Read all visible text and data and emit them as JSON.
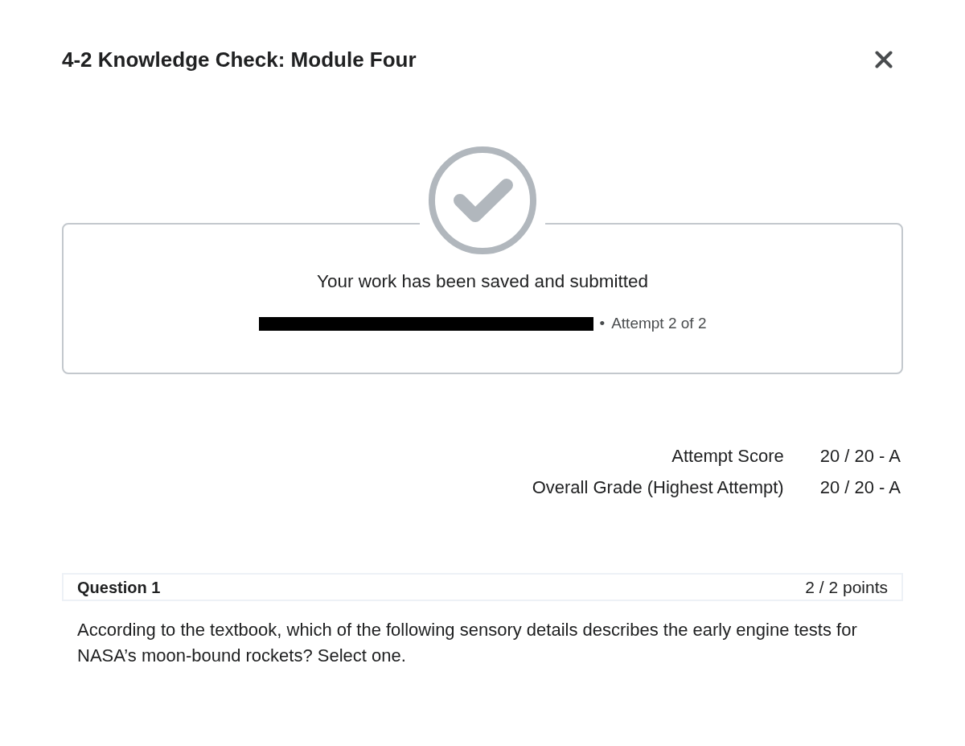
{
  "dialog": {
    "title": "4-2 Knowledge Check: Module Four"
  },
  "submission": {
    "message": "Your work has been saved and submitted",
    "redacted": true,
    "separator": "•",
    "attempt": "Attempt 2 of 2"
  },
  "scores": [
    {
      "label": "Attempt Score",
      "value": "20 / 20 - A"
    },
    {
      "label": "Overall Grade (Highest Attempt)",
      "value": "20 / 20 - A"
    }
  ],
  "questions": [
    {
      "title": "Question 1",
      "points": "2 / 2 points",
      "text": "According to the textbook, which of the following sensory details describes the early engine tests for NASA’s moon-bound rockets? Select one."
    }
  ]
}
